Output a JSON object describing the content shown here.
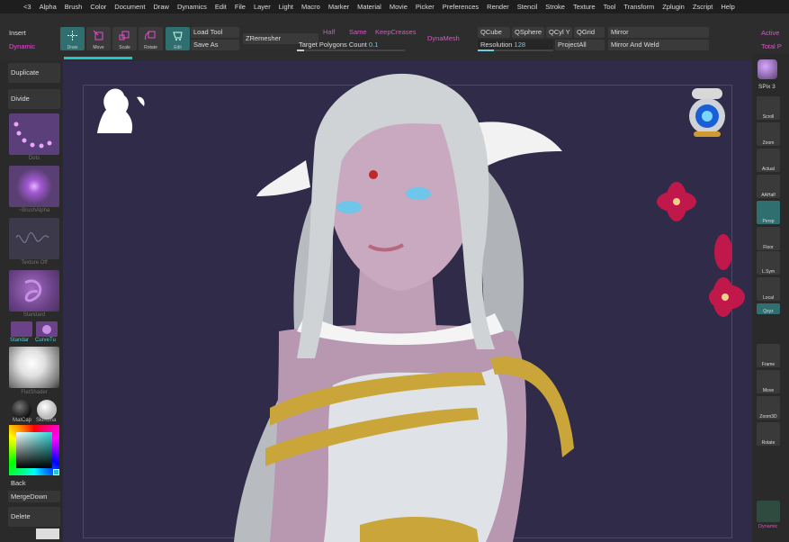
{
  "menu": [
    "<3",
    "Alpha",
    "Brush",
    "Color",
    "Document",
    "Draw",
    "Dynamics",
    "Edit",
    "File",
    "Layer",
    "Light",
    "Macro",
    "Marker",
    "Material",
    "Movie",
    "Picker",
    "Preferences",
    "Render",
    "Stencil",
    "Stroke",
    "Texture",
    "Tool",
    "Transform",
    "Zplugin",
    "Zscript",
    "Help"
  ],
  "topleft": {
    "insert": "Insert",
    "dynamic": "Dynamic"
  },
  "topright": {
    "active": "Active",
    "total": "Total P"
  },
  "toolbar": {
    "draw": "Draw",
    "move": "Move",
    "scale": "Scale",
    "rotate": "Rotate",
    "edit": "Edit",
    "load_tool": "Load Tool",
    "save_as": "Save As",
    "zremesher": "ZRemesher",
    "half": "Half",
    "same": "Same",
    "keepcreases": "KeepCreases",
    "target_label": "Target Polygons Count",
    "target_value": "0.1",
    "dynamesh": "DynaMesh",
    "qcube": "QCube",
    "qsphere": "QSphere",
    "qcyly": "QCyl Y",
    "qgrid": "QGrid",
    "resolution_label": "Resolution",
    "resolution_value": "128",
    "projectall": "ProjectAll",
    "mirror": "Mirror",
    "mirror_weld": "Mirror And Weld"
  },
  "left": {
    "duplicate": "Duplicate",
    "divide": "Divide",
    "dots": "Dots",
    "brushalpha": "~BrushAlpha",
    "texture_off": "Texture Off",
    "standard": "Standard",
    "standar_small": "Standar",
    "curvetu": "CurveTu",
    "flatshader": "FlatShader",
    "matcap1": "MatCap",
    "skinshade": "SkinSha",
    "back": "Back",
    "mergedown": "MergeDown",
    "delete": "Delete"
  },
  "right": {
    "spix": "SPix 3",
    "scroll": "Scroll",
    "zoom": "Zoom",
    "actual": "Actual",
    "aahalf": "AAHalf",
    "persp": "Persp",
    "floor": "Floor",
    "lsym": "L.Sym",
    "local": "Local",
    "xyz": "Qxyz",
    "frame": "Frame",
    "move": "Move",
    "zoom3d": "Zoom3D",
    "rotate": "Rotate",
    "dynamic": "Dynamic"
  },
  "colors": {
    "accent": "#e24fcf",
    "teal": "#2f6f6f",
    "canvas": "#2f2b48",
    "progress": "#21c6c6"
  }
}
